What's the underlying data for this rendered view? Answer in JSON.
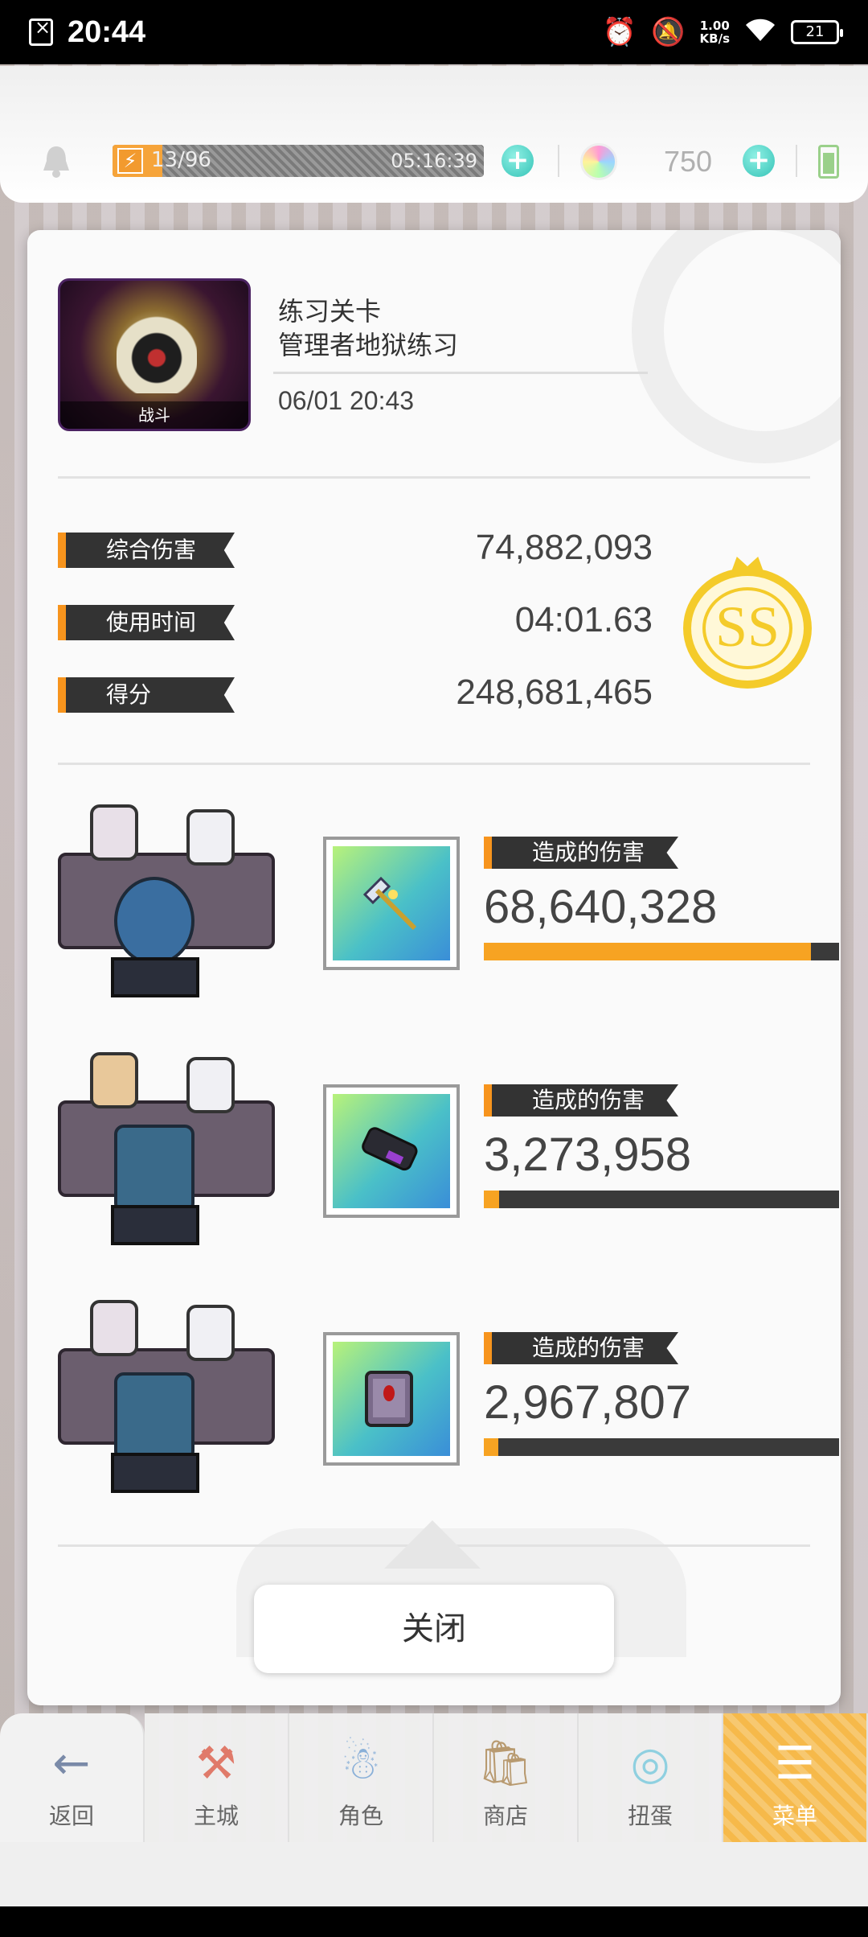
{
  "status_bar": {
    "time": "20:44",
    "speed_value": "1.00",
    "speed_unit": "KB/s",
    "battery": "21"
  },
  "top_bar": {
    "energy": "13/96",
    "energy_fill_fraction": 0.135,
    "energy_timer": "05:16:39",
    "gem_count": "750"
  },
  "result": {
    "stage_thumb_label": "战斗",
    "stage_type": "练习关卡",
    "stage_name": "管理者地狱练习",
    "date": "06/01 20:43",
    "stats": [
      {
        "label": "综合伤害",
        "value": "74,882,093"
      },
      {
        "label": "使用时间",
        "value": "04:01.63"
      },
      {
        "label": "得分",
        "value": "248,681,465"
      }
    ],
    "rank": "SS",
    "members": [
      {
        "damage_label": "造成的伤害",
        "damage": "68,640,328",
        "damage_fraction": 0.92,
        "weapon_icon": "axe-icon"
      },
      {
        "damage_label": "造成的伤害",
        "damage": "3,273,958",
        "damage_fraction": 0.044,
        "weapon_icon": "gauntlet-icon"
      },
      {
        "damage_label": "造成的伤害",
        "damage": "2,967,807",
        "damage_fraction": 0.04,
        "weapon_icon": "spellbook-icon"
      }
    ],
    "close_label": "关闭"
  },
  "bottom_nav": [
    {
      "label": "返回",
      "icon": "back-arrow-icon"
    },
    {
      "label": "主城",
      "icon": "town-icon"
    },
    {
      "label": "角色",
      "icon": "character-icon"
    },
    {
      "label": "商店",
      "icon": "shop-icon"
    },
    {
      "label": "扭蛋",
      "icon": "gacha-icon"
    },
    {
      "label": "菜单",
      "icon": "menu-icon"
    }
  ],
  "colors": {
    "accent_orange": "#f7941d",
    "rank_gold": "#f4cb2a",
    "plus_teal": "#35c3b7"
  }
}
